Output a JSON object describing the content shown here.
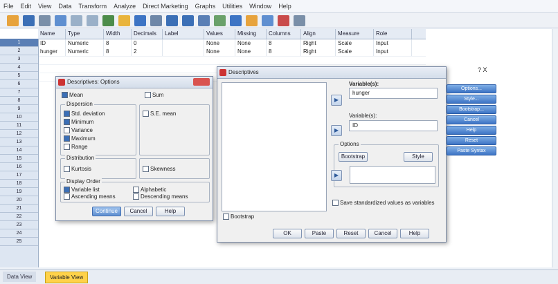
{
  "menu": [
    "File",
    "Edit",
    "View",
    "Data",
    "Transform",
    "Analyze",
    "Direct Marketing",
    "Graphs",
    "Utilities",
    "Window",
    "Help"
  ],
  "grid": {
    "columns": [
      "Name",
      "Type",
      "Width",
      "Decimals",
      "Label",
      "Values",
      "Missing",
      "Columns",
      "Align",
      "Measure",
      "Role"
    ],
    "rows": [
      [
        "1",
        "ID",
        "Numeric",
        "8",
        "0",
        "",
        "None",
        "None",
        "8",
        "Right",
        "Scale",
        "Input"
      ],
      [
        "2",
        "hunger",
        "Numeric",
        "8",
        "2",
        "",
        "None",
        "None",
        "8",
        "Right",
        "Scale",
        "Input"
      ]
    ],
    "row_numbers": [
      "1",
      "2",
      "3",
      "4",
      "5",
      "6",
      "7",
      "8",
      "9",
      "10",
      "11",
      "12",
      "13",
      "14",
      "15",
      "16",
      "17",
      "18",
      "19",
      "20",
      "21",
      "22",
      "23",
      "24",
      "25"
    ]
  },
  "tabs": {
    "left": "Data View",
    "active": "Variable View"
  },
  "options_dialog": {
    "title": "Descriptives: Options",
    "mean": "Mean",
    "sum": "Sum",
    "dispersion_title": "Dispersion",
    "dispersion": [
      "Std. deviation",
      "Minimum",
      "Variance",
      "Maximum",
      "Range",
      "S.E. mean"
    ],
    "distribution_title": "Distribution",
    "distribution": [
      "Kurtosis",
      "Skewness"
    ],
    "display_order_title": "Display Order",
    "display_order": [
      "Variable list",
      "Alphabetic",
      "Ascending means",
      "Descending means"
    ],
    "continue": "Continue",
    "cancel": "Cancel",
    "help": "Help"
  },
  "descriptives_dialog": {
    "title": "Descriptives",
    "variables_label": "Variable(s):",
    "variable_value": "hunger",
    "second_label": "Variable(s):",
    "second_value": "ID",
    "sub_label": "Options",
    "sub_btn1": "Bootstrap",
    "sub_btn2": "Style",
    "save_label": "Save standardized values as variables",
    "checkbox2": "Bootstrap",
    "buttons": [
      "OK",
      "Paste",
      "Reset",
      "Cancel",
      "Help"
    ],
    "side_buttons": [
      "Options...",
      "Style...",
      "Bootstrap..."
    ],
    "corner": "? X"
  },
  "right_buttons": [
    "Options...",
    "Style...",
    "Bootstrap...",
    "Cancel",
    "Help",
    "Reset",
    "Paste Syntax"
  ],
  "colors": {
    "accent": "#3b6fb6",
    "tab_active": "#ffd24a"
  }
}
